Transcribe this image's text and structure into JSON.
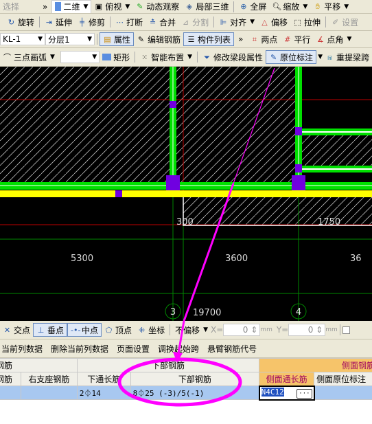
{
  "toolbar1": {
    "select": "选择",
    "view2d": "二维",
    "topview": "俯视",
    "orbit": "动态观察",
    "local3d": "局部三维",
    "fullscreen": "全屏",
    "zoom": "缩放",
    "pan": "平移"
  },
  "toolbar2": {
    "rotate": "旋转",
    "extend": "延伸",
    "trim": "修剪",
    "break": "打断",
    "merge": "合并",
    "split": "分割",
    "align": "对齐",
    "offset": "偏移",
    "stretch": "拉伸",
    "settings": "设置"
  },
  "toolbar3": {
    "component": "KL-1",
    "layer": "分层1",
    "properties": "属性",
    "edit_rebar": "编辑钢筋",
    "component_list": "构件列表",
    "two_point": "两点",
    "parallel": "平行",
    "point_angle": "点角"
  },
  "toolbar4": {
    "arc": "三点画弧",
    "blank_select": "",
    "rect": "矩形",
    "smart_place": "智能布置",
    "modify_span": "修改梁段属性",
    "inplace_mark": "原位标注",
    "re_span": "重提梁跨"
  },
  "canvas": {
    "dims": [
      "300",
      "1750",
      "5300",
      "3600",
      "36",
      "19700"
    ],
    "axes": [
      "3",
      "4"
    ]
  },
  "snap": {
    "intersection": "交点",
    "perpendicular": "垂点",
    "midpoint": "中点",
    "vertex": "顶点",
    "coordinate": "坐标",
    "offset_mode": "不偏移",
    "x_label": "X=",
    "x_value": "0",
    "y_label": "Y=",
    "y_value": "0",
    "unit": "mm"
  },
  "menu": [
    "当前列数据",
    "删除当前列数据",
    "页面设置",
    "调换起始跨",
    "悬臂钢筋代号"
  ],
  "table": {
    "group_headers": [
      "钢筋",
      "下部钢筋",
      "侧面钢筋"
    ],
    "columns": [
      "钢筋",
      "右支座钢筋",
      "下通长筋",
      "下部钢筋",
      "侧面通长筋",
      "侧面原位标注"
    ],
    "row": [
      "",
      "",
      "2⏀14",
      "8⏀25 (-3)/5(-1)",
      "N4C12",
      ""
    ]
  },
  "colors": {
    "beam": "#00e000",
    "yellow": "#ffff00",
    "column": "#7000e0",
    "annotation": "#ff00ff",
    "header_orange": "#f6c46a",
    "selected_row": "#a8c8f0"
  }
}
